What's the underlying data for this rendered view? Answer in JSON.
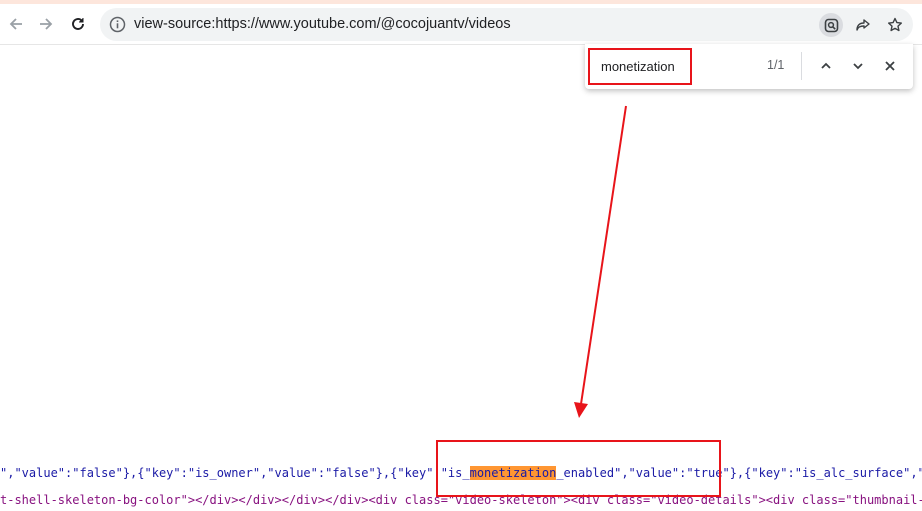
{
  "browser": {
    "back_icon": "arrow-left-icon",
    "forward_icon": "arrow-right-icon",
    "reload_icon": "reload-icon",
    "url": "view-source:https://www.youtube.com/@cocojuantv/videos",
    "info_icon": "info-icon",
    "find_icon": "search-page-icon",
    "share_icon": "share-icon",
    "bookmark_icon": "star-icon"
  },
  "find_bar": {
    "query": "monetization",
    "count": "1/1",
    "prev_icon": "chevron-up-icon",
    "next_icon": "chevron-down-icon",
    "close_icon": "close-icon"
  },
  "source": {
    "line1_before": "\",\"value\":\"false\"},{\"key\":\"is_owner\",\"value\":\"false\"},{\"key\":\"is_",
    "line1_match": "monetization",
    "line1_after": "_enabled\",\"value\":\"true\"},{\"key\":\"is_alc_surface\",\"valu",
    "line2_text": "t-shell-skeleton-bg-color\"></div></div></div></div><div class=\"video-skeleton\"><div class=\"video-details\"><div class=\"thumbnail-ske"
  },
  "annotations": {
    "highlight_color": "#ff9632",
    "annotation_color": "#e8141a"
  }
}
